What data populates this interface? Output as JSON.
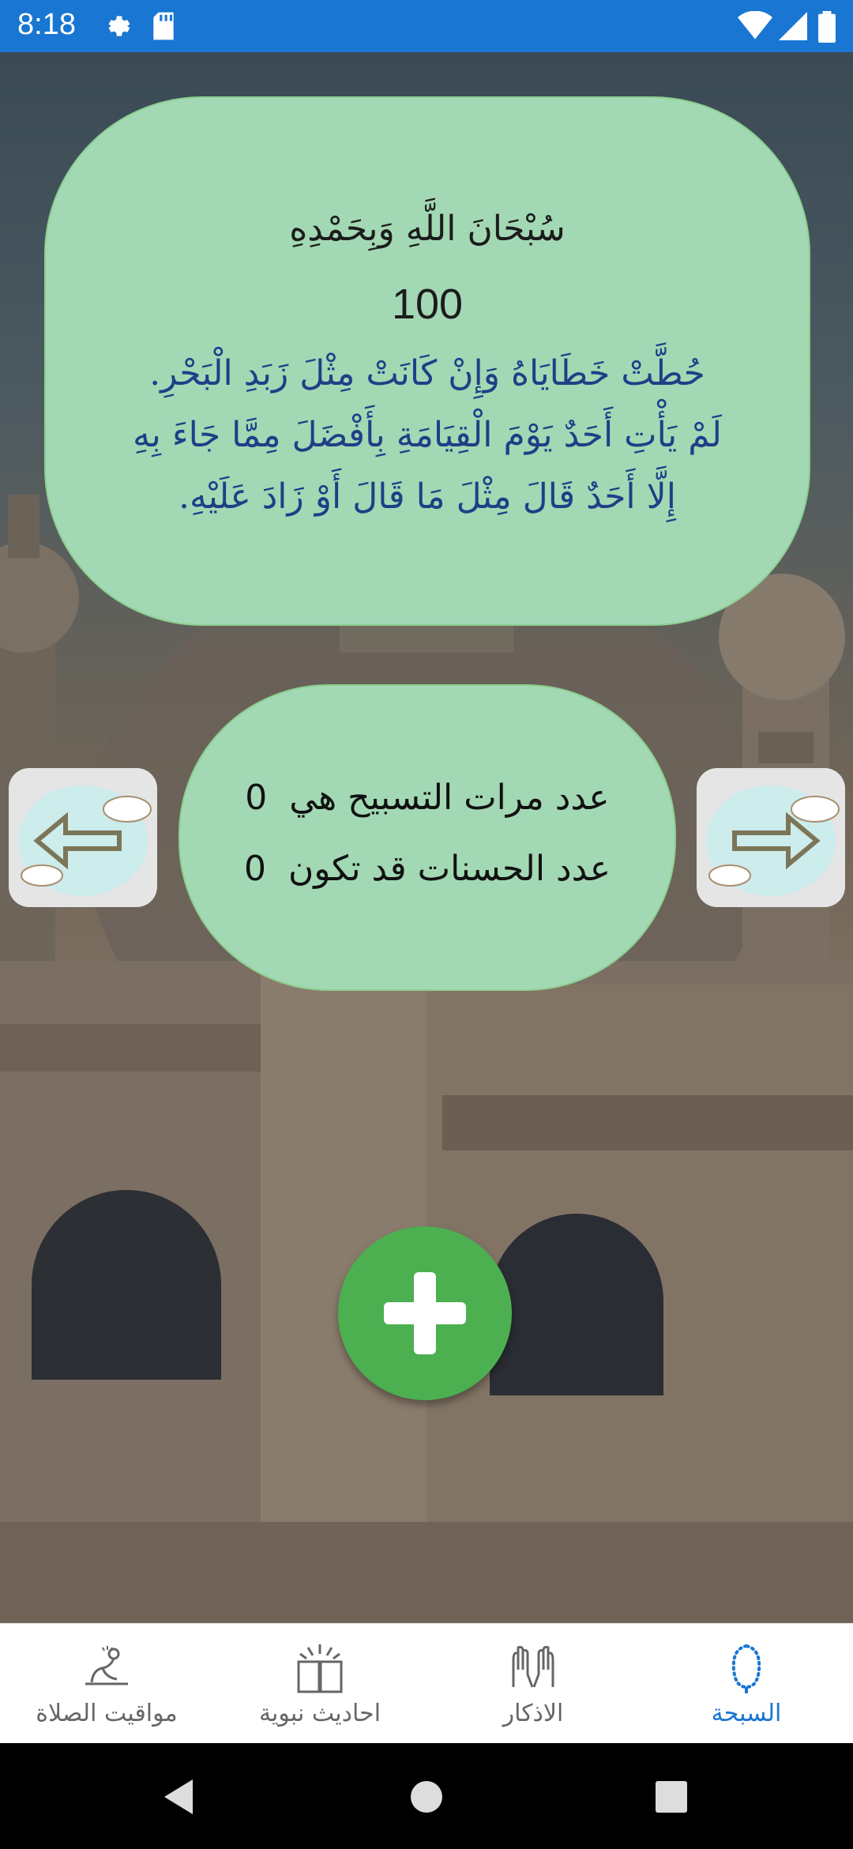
{
  "status_bar": {
    "time": "8:18",
    "icons": [
      "gear-icon",
      "sd-card-icon",
      "wifi-icon",
      "signal-icon",
      "battery-icon"
    ],
    "background_color": "#1976d2"
  },
  "dhikr": {
    "title": "سُبْحَانَ اللَّهِ وَبِحَمْدِهِ",
    "count": "100",
    "virtue": "حُطَّتْ خَطَايَاهُ وَإِنْ كَانَتْ مِثْلَ زَبَدِ الْبَحْرِ. لَمْ يَأْتِ أَحَدٌ يَوْمَ الْقِيَامَةِ بِأَفْضَلَ مِمَّا جَاءَ بِهِ إِلَّا أَحَدٌ قَالَ مِثْلَ مَا قَالَ أَوْ زَادَ عَلَيْهِ."
  },
  "stats": {
    "tasbeeh_label": "عدد مرات التسبيح هي",
    "tasbeeh_value": "0",
    "hasanat_label": "عدد الحسنات قد تكون",
    "hasanat_value": "0"
  },
  "buttons": {
    "prev_icon": "arrow-left-icon",
    "next_icon": "arrow-right-icon",
    "add_icon": "plus-icon",
    "add_color": "#4caf50"
  },
  "bottom_nav": {
    "items": [
      {
        "label": "مواقيت الصلاة",
        "icon": "prayer-icon",
        "active": false
      },
      {
        "label": "احاديث نبوية",
        "icon": "book-icon",
        "active": false
      },
      {
        "label": "الاذكار",
        "icon": "praying-hands-icon",
        "active": false
      },
      {
        "label": "السبحة",
        "icon": "tasbih-icon",
        "active": true
      }
    ],
    "active_color": "#1976d2"
  }
}
